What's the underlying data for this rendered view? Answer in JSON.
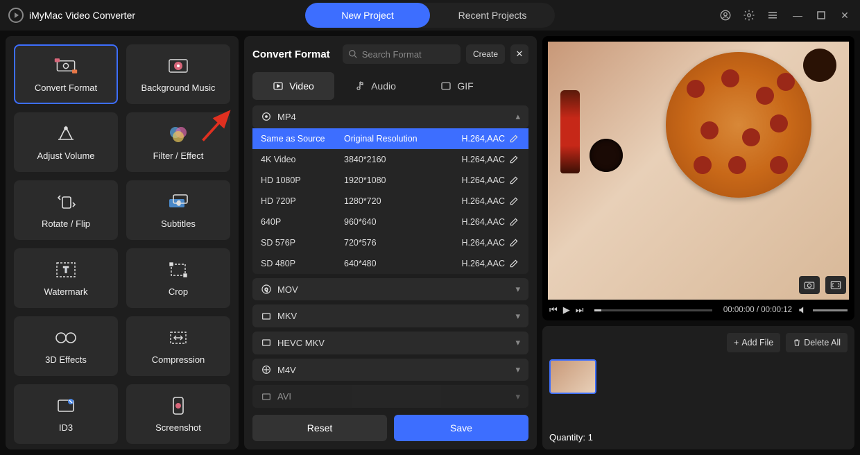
{
  "app": {
    "title": "iMyMac Video Converter"
  },
  "topTabs": {
    "newProject": "New Project",
    "recentProjects": "Recent Projects"
  },
  "tools": [
    {
      "key": "convert-format",
      "label": "Convert Format",
      "active": true
    },
    {
      "key": "background-music",
      "label": "Background Music"
    },
    {
      "key": "adjust-volume",
      "label": "Adjust Volume"
    },
    {
      "key": "filter-effect",
      "label": "Filter / Effect"
    },
    {
      "key": "rotate-flip",
      "label": "Rotate / Flip"
    },
    {
      "key": "subtitles",
      "label": "Subtitles"
    },
    {
      "key": "watermark",
      "label": "Watermark"
    },
    {
      "key": "crop",
      "label": "Crop"
    },
    {
      "key": "3d-effects",
      "label": "3D Effects"
    },
    {
      "key": "compression",
      "label": "Compression"
    },
    {
      "key": "id3",
      "label": "ID3"
    },
    {
      "key": "screenshot",
      "label": "Screenshot"
    }
  ],
  "center": {
    "title": "Convert Format",
    "searchPlaceholder": "Search Format",
    "createLabel": "Create",
    "tabs": {
      "video": "Video",
      "audio": "Audio",
      "gif": "GIF"
    },
    "resetLabel": "Reset",
    "saveLabel": "Save"
  },
  "formatGroups": {
    "mp4": "MP4",
    "mov": "MOV",
    "mkv": "MKV",
    "hevcmkv": "HEVC MKV",
    "m4v": "M4V",
    "avi": "AVI"
  },
  "mp4Presets": [
    {
      "name": "Same as Source",
      "res": "Original Resolution",
      "codec": "H.264,AAC",
      "selected": true
    },
    {
      "name": "4K Video",
      "res": "3840*2160",
      "codec": "H.264,AAC"
    },
    {
      "name": "HD 1080P",
      "res": "1920*1080",
      "codec": "H.264,AAC"
    },
    {
      "name": "HD 720P",
      "res": "1280*720",
      "codec": "H.264,AAC"
    },
    {
      "name": "640P",
      "res": "960*640",
      "codec": "H.264,AAC"
    },
    {
      "name": "SD 576P",
      "res": "720*576",
      "codec": "H.264,AAC"
    },
    {
      "name": "SD 480P",
      "res": "640*480",
      "codec": "H.264,AAC"
    }
  ],
  "player": {
    "current": "00:00:00",
    "total": "00:00:12"
  },
  "filePanel": {
    "addFile": "Add File",
    "deleteAll": "Delete All",
    "quantityLabel": "Quantity:",
    "quantityValue": "1"
  },
  "colors": {
    "accent": "#3d6eff"
  }
}
